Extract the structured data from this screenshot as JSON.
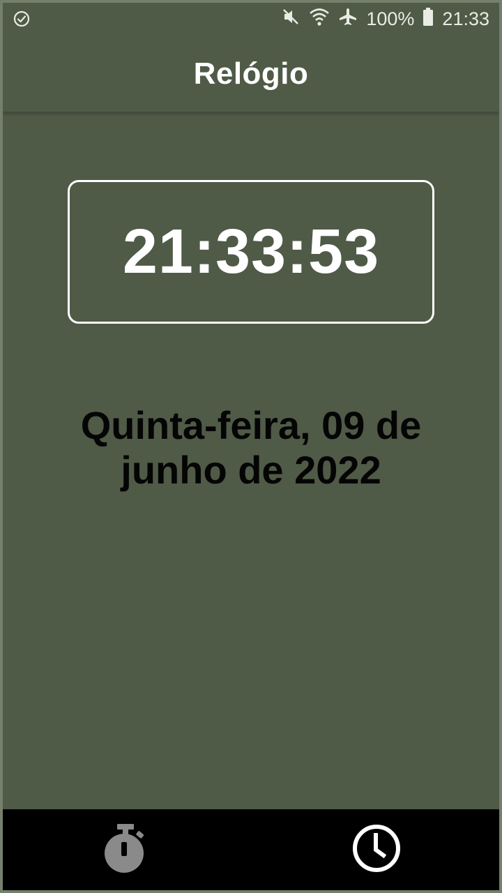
{
  "status_bar": {
    "left_icon": "check-circle-icon",
    "icons": [
      "mute-icon",
      "wifi-icon",
      "airplane-icon"
    ],
    "battery_percent": "100%",
    "time": "21:33"
  },
  "app_bar": {
    "title": "Relógio"
  },
  "clock": {
    "time": "21:33:53",
    "date": "Quinta-feira, 09 de junho de 2022"
  },
  "bottom_nav": {
    "items": [
      {
        "icon": "stopwatch-icon",
        "active": false
      },
      {
        "icon": "clock-icon",
        "active": true
      }
    ]
  },
  "colors": {
    "background": "#4f5a47",
    "text_primary": "#ffffff",
    "date_text": "#050505",
    "nav_background": "#000000",
    "nav_inactive": "#888888",
    "nav_active": "#ffffff"
  }
}
